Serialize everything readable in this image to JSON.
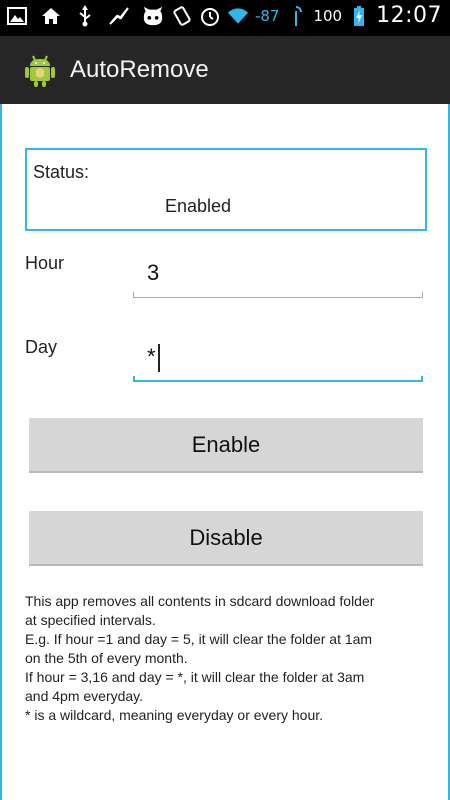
{
  "status_bar": {
    "signal_text": "-87",
    "battery_text": "100",
    "time": "12:07"
  },
  "app": {
    "title": "AutoRemove"
  },
  "status": {
    "label": "Status:",
    "value": "Enabled"
  },
  "form": {
    "hour_label": "Hour",
    "hour_value": "3",
    "day_label": "Day",
    "day_value": "*"
  },
  "buttons": {
    "enable": "Enable",
    "disable": "Disable"
  },
  "description": {
    "line1": "This app removes all contents in sdcard download folder",
    "line2": "at specified intervals.",
    "line3": "E.g. If hour =1 and day = 5, it will clear the folder at 1am",
    "line4": "on the 5th of every month.",
    "line5": "If hour = 3,16 and day = *, it will clear the folder at 3am",
    "line6": "and 4pm everyday.",
    "line7": "* is a wildcard, meaning everyday or every hour."
  },
  "colors": {
    "accent": "#33b5e5",
    "actionbar": "#262626",
    "button": "#d6d6d6"
  }
}
